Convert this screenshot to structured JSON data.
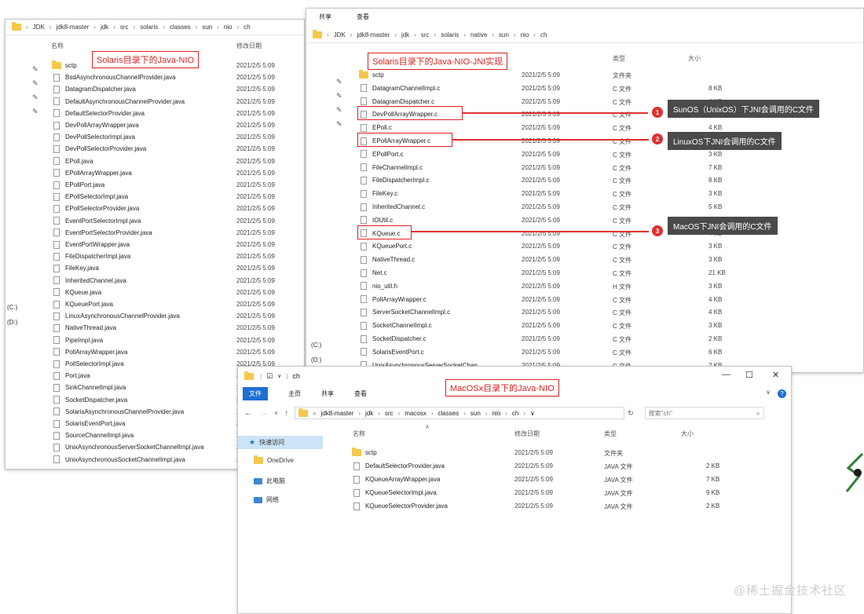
{
  "win1": {
    "breadcrumb": [
      "JDK",
      "jdk8-master",
      "jdk",
      "src",
      "solaris",
      "classes",
      "sun",
      "nio",
      "ch"
    ],
    "col_name": "名称",
    "col_modified": "修改日期",
    "label": "Solaris目录下的Java-NIO",
    "drives": [
      "(C:)",
      "(D:)"
    ],
    "date": "2021/2/5 5:09",
    "files": [
      "sctp",
      "BsdAsynchronousChannelProvider.java",
      "DatagramDispatcher.java",
      "DefaultAsynchronousChannelProvider.java",
      "DefaultSelectorProvider.java",
      "DevPollArrayWrapper.java",
      "DevPollSelectorImpl.java",
      "DevPollSelectorProvider.java",
      "EPoll.java",
      "EPollArrayWrapper.java",
      "EPollPort.java",
      "EPollSelectorImpl.java",
      "EPollSelectorProvider.java",
      "EventPortSelectorImpl.java",
      "EventPortSelectorProvider.java",
      "EventPortWrapper.java",
      "FileDispatcherImpl.java",
      "FileKey.java",
      "InheritedChannel.java",
      "KQueue.java",
      "KQueuePort.java",
      "LinuxAsynchronousChannelProvider.java",
      "NativeThread.java",
      "PipeImpl.java",
      "PollArrayWrapper.java",
      "PollSelectorImpl.java",
      "Port.java",
      "SinkChannelImpl.java",
      "SocketDispatcher.java",
      "SolarisAsynchronousChannelProvider.java",
      "SolarisEventPort.java",
      "SourceChannelImpl.java",
      "UnixAsynchronousServerSocketChannelImpl.java",
      "UnixAsynchronousSocketChannelImpl.java"
    ]
  },
  "win2": {
    "tabs": [
      "共享",
      "查看"
    ],
    "breadcrumb": [
      "JDK",
      "jdk8-master",
      "jdk",
      "src",
      "solaris",
      "native",
      "sun",
      "nio",
      "ch"
    ],
    "col_type": "类型",
    "col_size": "大小",
    "label": "Solaris目录下的Java-NIO-JNI实现",
    "drives": [
      "(C:)",
      "(D:)"
    ],
    "date": "2021/2/5 5:09",
    "files": [
      {
        "name": "sctp",
        "type": "文件夹",
        "size": "",
        "folder": true
      },
      {
        "name": "DatagramChannelImpl.c",
        "type": "C 文件",
        "size": "8 KB"
      },
      {
        "name": "DatagramDispatcher.c",
        "type": "C 文件",
        "size": "4 KB"
      },
      {
        "name": "DevPollArrayWrapper.c",
        "type": "C 文件",
        "size": "6 KB"
      },
      {
        "name": "EPoll.c",
        "type": "C 文件",
        "size": "4 KB"
      },
      {
        "name": "EPollArrayWrapper.c",
        "type": "C 文件",
        "size": "6 KB"
      },
      {
        "name": "EPollPort.c",
        "type": "C 文件",
        "size": "3 KB"
      },
      {
        "name": "FileChannelImpl.c",
        "type": "C 文件",
        "size": "7 KB"
      },
      {
        "name": "FileDispatcherImpl.c",
        "type": "C 文件",
        "size": "8 KB"
      },
      {
        "name": "FileKey.c",
        "type": "C 文件",
        "size": "3 KB"
      },
      {
        "name": "InheritedChannel.c",
        "type": "C 文件",
        "size": "5 KB"
      },
      {
        "name": "IOUtil.c",
        "type": "C 文件",
        "size": "6 KB"
      },
      {
        "name": "KQueue.c",
        "type": "C 文件",
        "size": "4 KB"
      },
      {
        "name": "KQueuePort.c",
        "type": "C 文件",
        "size": "3 KB"
      },
      {
        "name": "NativeThread.c",
        "type": "C 文件",
        "size": "3 KB"
      },
      {
        "name": "Net.c",
        "type": "C 文件",
        "size": "21 KB"
      },
      {
        "name": "nio_util.h",
        "type": "H 文件",
        "size": "3 KB"
      },
      {
        "name": "PollArrayWrapper.c",
        "type": "C 文件",
        "size": "4 KB"
      },
      {
        "name": "ServerSocketChannelImpl.c",
        "type": "C 文件",
        "size": "4 KB"
      },
      {
        "name": "SocketChannelImpl.c",
        "type": "C 文件",
        "size": "3 KB"
      },
      {
        "name": "SocketDispatcher.c",
        "type": "C 文件",
        "size": "2 KB"
      },
      {
        "name": "SolarisEventPort.c",
        "type": "C 文件",
        "size": "6 KB"
      },
      {
        "name": "UnixAsynchronousServerSocketChan...",
        "type": "C 文件",
        "size": "2 KB"
      }
    ],
    "callouts": [
      "SunOS（UnixOS）下JNI会调用的C文件",
      "LinuxOS下JNI会调用的C文件",
      "MacOS下JNI会调用的C文件"
    ],
    "callout_nums": [
      "1",
      "2",
      "3"
    ]
  },
  "win3": {
    "title": "ch",
    "tabs": [
      "文件",
      "主页",
      "共享",
      "查看"
    ],
    "breadcrumb": [
      "jdk8-master",
      "jdk",
      "src",
      "macosx",
      "classes",
      "sun",
      "nio",
      "ch"
    ],
    "search_placeholder": "搜索\"ch\"",
    "label": "MacOSx目录下的Java-NIO",
    "nav": [
      "快速访问",
      "OneDrive",
      "此电脑",
      "网络"
    ],
    "cols": [
      "名称",
      "修改日期",
      "类型",
      "大小"
    ],
    "files": [
      {
        "name": "sctp",
        "date": "2021/2/5 5:09",
        "type": "文件夹",
        "size": "",
        "folder": true
      },
      {
        "name": "DefaultSelectorProvider.java",
        "date": "2021/2/5 5:09",
        "type": "JAVA 文件",
        "size": "2 KB"
      },
      {
        "name": "KQueueArrayWrapper.java",
        "date": "2021/2/5 5:09",
        "type": "JAVA 文件",
        "size": "7 KB"
      },
      {
        "name": "KQueueSelectorImpl.java",
        "date": "2021/2/5 5:09",
        "type": "JAVA 文件",
        "size": "9 KB"
      },
      {
        "name": "KQueueSelectorProvider.java",
        "date": "2021/2/5 5:09",
        "type": "JAVA 文件",
        "size": "2 KB"
      }
    ]
  },
  "watermark": "@稀土掘金技术社区"
}
